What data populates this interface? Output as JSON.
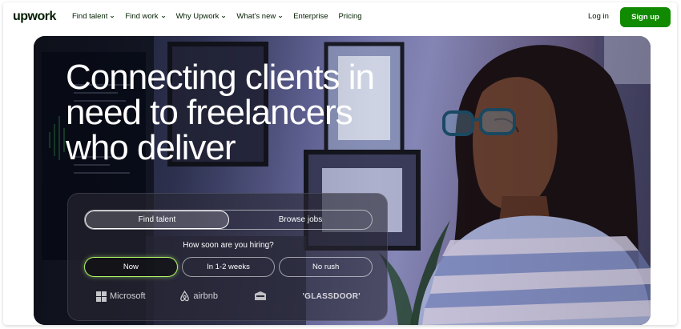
{
  "brand": {
    "logo": "upwork"
  },
  "nav": {
    "items": [
      {
        "label": "Find talent",
        "dropdown": true
      },
      {
        "label": "Find work",
        "dropdown": true
      },
      {
        "label": "Why Upwork",
        "dropdown": true
      },
      {
        "label": "What's new",
        "dropdown": true
      },
      {
        "label": "Enterprise",
        "dropdown": false
      },
      {
        "label": "Pricing",
        "dropdown": false
      }
    ],
    "login": "Log in",
    "signup": "Sign up"
  },
  "hero": {
    "headline": "Connecting clients in need to freelancers who deliver",
    "tabs": [
      {
        "label": "Find talent",
        "selected": true
      },
      {
        "label": "Browse jobs",
        "selected": false
      }
    ],
    "question": "How soon are you hiring?",
    "options": [
      {
        "label": "Now",
        "selected": true
      },
      {
        "label": "In 1-2 weeks",
        "selected": false
      },
      {
        "label": "No rush",
        "selected": false
      }
    ],
    "client_logos": [
      {
        "name": "Microsoft",
        "icon": "microsoft-icon"
      },
      {
        "name": "airbnb",
        "icon": "airbnb-icon"
      },
      {
        "name": "",
        "icon": "bissell-icon"
      },
      {
        "name": "'GLASSDOOR'",
        "icon": "glassdoor-icon"
      }
    ]
  },
  "colors": {
    "brand_green": "#108a00",
    "accent_lime": "#b2f56c",
    "text_dark": "#001e00"
  }
}
